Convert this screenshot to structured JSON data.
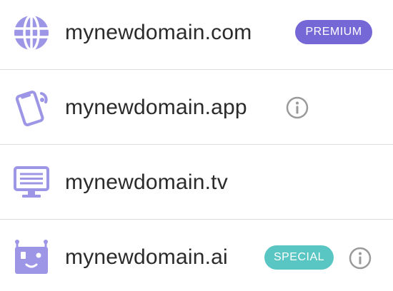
{
  "domains": [
    {
      "name": "mynewdomain.com",
      "icon": "globe-icon",
      "badge": "PREMIUM",
      "badge_color": "#7667d6",
      "info": false
    },
    {
      "name": "mynewdomain.app",
      "icon": "phone-icon",
      "badge": "",
      "info": true
    },
    {
      "name": "mynewdomain.tv",
      "icon": "tv-monitor-icon",
      "badge": "",
      "info": false
    },
    {
      "name": "mynewdomain.ai",
      "icon": "robot-icon",
      "badge": "SPECIAL",
      "badge_color": "#5ac6c4",
      "info": true
    }
  ],
  "colors": {
    "icon": "#9d95e6",
    "text": "#2b2b2b",
    "divider": "#dcdcdc",
    "info_icon": "#9a9a9a"
  }
}
